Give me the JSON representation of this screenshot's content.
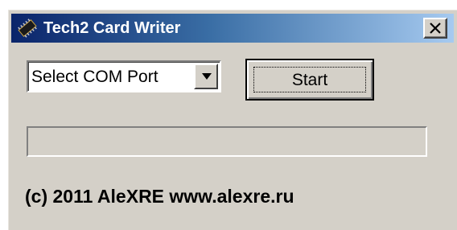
{
  "window": {
    "title": "Tech2 Card Writer",
    "close_glyph": "✕",
    "icon": "chip-icon",
    "colors": {
      "title_gradient_start": "#0a246a",
      "title_gradient_end": "#a6caf0",
      "face": "#d4d0c8"
    }
  },
  "com_port": {
    "selected": "Select COM Port",
    "arrow_icon": "dropdown-arrow-icon"
  },
  "start_button": {
    "label": "Start"
  },
  "progress": {
    "value_percent": 0
  },
  "footer": {
    "copyright": "(c) 2011 AleXRE www.alexre.ru"
  }
}
